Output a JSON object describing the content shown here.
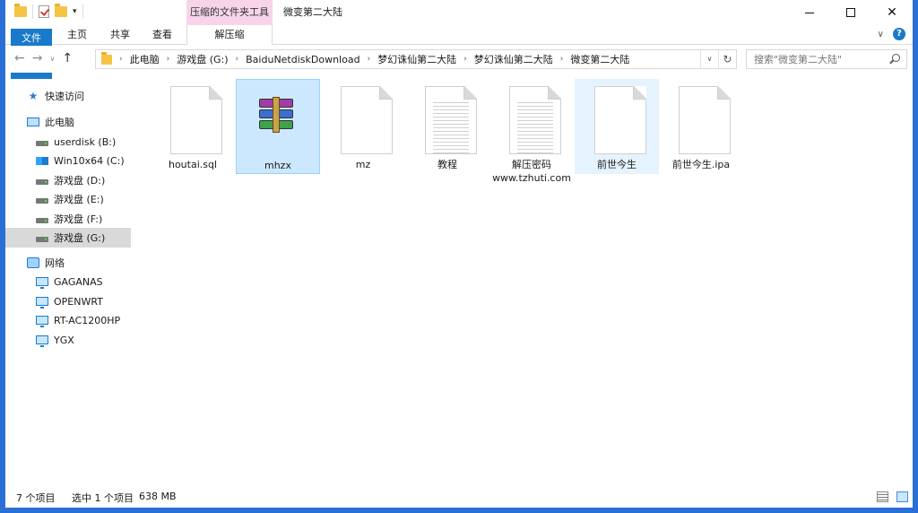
{
  "titlebar": {
    "context_tab": "压缩的文件夹工具",
    "title": "微变第二大陆",
    "minimize": "—",
    "close": "✕"
  },
  "ribbon": {
    "tabs": [
      "文件",
      "主页",
      "共享",
      "查看",
      "解压缩"
    ]
  },
  "address": {
    "crumbs": [
      "此电脑",
      "游戏盘 (G:)",
      "BaiduNetdiskDownload",
      "梦幻诛仙第二大陆",
      "梦幻诛仙第二大陆",
      "微变第二大陆"
    ]
  },
  "search": {
    "placeholder": "搜索\"微变第二大陆\""
  },
  "sidebar": {
    "quick_access": "快速访问",
    "this_pc": "此电脑",
    "drives": [
      "userdisk (B:)",
      "Win10x64 (C:)",
      "游戏盘 (D:)",
      "游戏盘 (E:)",
      "游戏盘 (F:)",
      "游戏盘 (G:)"
    ],
    "network": "网络",
    "network_items": [
      "GAGANAS",
      "OPENWRT",
      "RT-AC1200HP",
      "YGX"
    ]
  },
  "files": [
    {
      "name": "houtai.sql",
      "icon": "document-icon"
    },
    {
      "name": "mhzx",
      "icon": "rar-archive-icon"
    },
    {
      "name": "mz",
      "icon": "document-icon"
    },
    {
      "name": "教程",
      "icon": "text-document-icon"
    },
    {
      "name": "解压密码 www.tzhuti.com",
      "icon": "text-document-icon"
    },
    {
      "name": "前世今生",
      "icon": "document-icon"
    },
    {
      "name": "前世今生.ipa",
      "icon": "document-icon"
    }
  ],
  "status": {
    "item_count": "7 个项目",
    "selected": "选中 1 个项目",
    "size": "638 MB"
  },
  "colors": {
    "accent": "#1979ca",
    "border": "#2a6fd6",
    "selection": "#cce8ff",
    "context_tab": "#f7d4ea"
  }
}
